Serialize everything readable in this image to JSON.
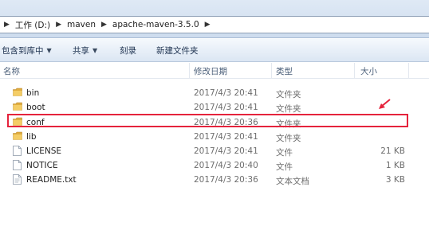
{
  "address": {
    "crumbs": [
      "工作 (D:)",
      "maven",
      "apache-maven-3.5.0"
    ]
  },
  "toolbar": {
    "include_library": "包含到库中",
    "share": "共享",
    "burn": "刻录",
    "new_folder": "新建文件夹"
  },
  "columns": {
    "name": "名称",
    "date": "修改日期",
    "type": "类型",
    "size": "大小"
  },
  "files": [
    {
      "name": "bin",
      "date": "2017/4/3 20:41",
      "type": "文件夹",
      "size": "",
      "icon": "folder-icon"
    },
    {
      "name": "boot",
      "date": "2017/4/3 20:41",
      "type": "文件夹",
      "size": "",
      "icon": "folder-icon"
    },
    {
      "name": "conf",
      "date": "2017/4/3 20:36",
      "type": "文件夹",
      "size": "",
      "icon": "folder-icon"
    },
    {
      "name": "lib",
      "date": "2017/4/3 20:41",
      "type": "文件夹",
      "size": "",
      "icon": "folder-icon"
    },
    {
      "name": "LICENSE",
      "date": "2017/4/3 20:41",
      "type": "文件",
      "size": "21 KB",
      "icon": "file-icon"
    },
    {
      "name": "NOTICE",
      "date": "2017/4/3 20:40",
      "type": "文件",
      "size": "1 KB",
      "icon": "file-icon"
    },
    {
      "name": "README.txt",
      "date": "2017/4/3 20:36",
      "type": "文本文档",
      "size": "3 KB",
      "icon": "text-file-icon"
    }
  ],
  "colors": {
    "highlight": "#e5233c",
    "folder": "#f2c45a"
  }
}
